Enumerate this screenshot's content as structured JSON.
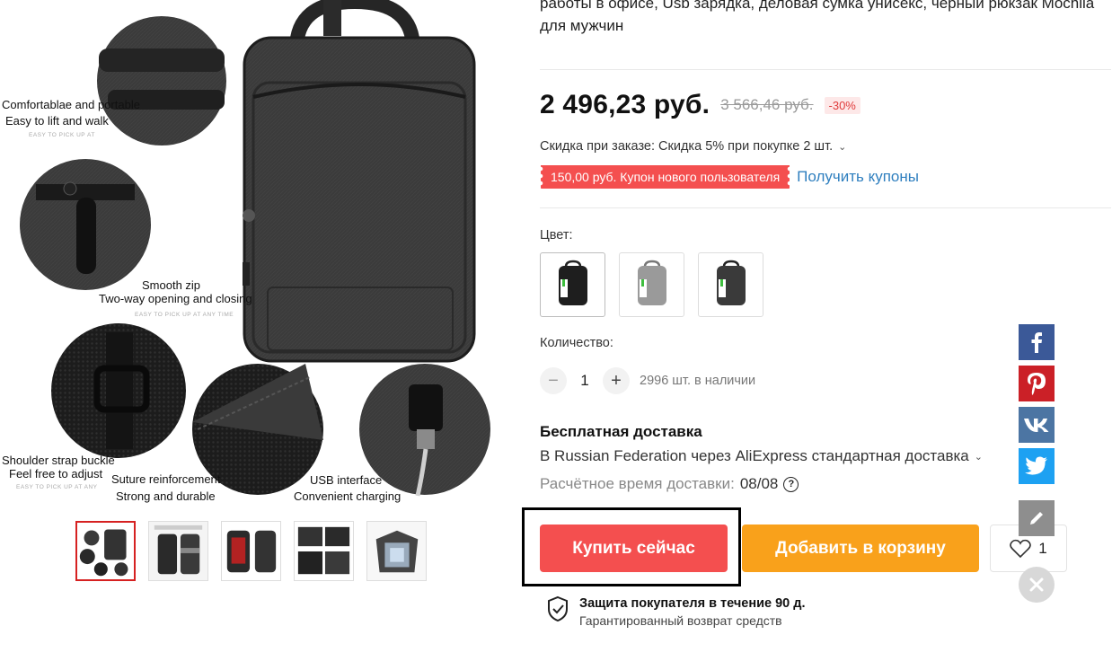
{
  "product": {
    "title": "работы в офисе, Usb зарядка, деловая сумка унисекс, черный рюкзак Mochila для мужчин"
  },
  "hero_image": {
    "captions": {
      "handle_1": "Comfortablae and portable",
      "handle_2": "Easy to lift and walk",
      "handle_small": "EASY TO PICK UP AT",
      "zip_1": "Smooth zip",
      "zip_2": "Two-way opening and closing",
      "zip_small": "EASY TO PICK UP AT ANY TIME",
      "buckle_1": "Shoulder strap buckle",
      "buckle_2": "Feel free to adjust",
      "buckle_small": "EASY TO PICK UP AT ANY",
      "suture_1": "Suture reinforcement",
      "suture_2": "Strong and durable",
      "usb_1": "USB interface",
      "usb_2": "Convenient charging"
    }
  },
  "thumbnails": [
    {
      "icon": "backpack-detail-thumbnail",
      "active": true
    },
    {
      "icon": "backpack-features-thumbnail"
    },
    {
      "icon": "backpack-red-lining-thumbnail"
    },
    {
      "icon": "backpack-pockets-thumbnail"
    },
    {
      "icon": "backpack-open-thumbnail"
    }
  ],
  "price": {
    "current": "2 496,23 руб.",
    "old": "3 566,46 руб.",
    "discount": "-30%"
  },
  "promo": {
    "text": "Скидка при заказе: Скидка 5% при покупке 2 шт."
  },
  "coupon": {
    "label": "150,00 руб. Купон нового пользователя",
    "get_link": "Получить купоны"
  },
  "color": {
    "label": "Цвет:",
    "options": [
      {
        "name": "black",
        "body": "#1e1e1e",
        "selected": true
      },
      {
        "name": "grey",
        "body": "#9a9a9a"
      },
      {
        "name": "dark-grey",
        "body": "#3a3a3a"
      }
    ]
  },
  "quantity": {
    "label": "Количество:",
    "value": "1",
    "stock": "2996 шт. в наличии"
  },
  "shipping": {
    "title": "Бесплатная доставка",
    "method": "В Russian Federation через AliExpress стандартная доставка",
    "eta_label": "Расчётное время доставки:",
    "eta_value": "08/08"
  },
  "actions": {
    "buy": "Купить сейчас",
    "add_to_cart": "Добавить в корзину",
    "wishlist_count": "1"
  },
  "protection": {
    "title": "Защита покупателя в течение 90 д.",
    "subtitle": "Гарантированный возврат средств"
  },
  "share": [
    "facebook-icon",
    "pinterest-icon",
    "vk-icon",
    "twitter-icon"
  ],
  "colors": {
    "accent_red": "#f44f4f",
    "accent_orange": "#f9a11b",
    "link_blue": "#2f7fbf"
  }
}
